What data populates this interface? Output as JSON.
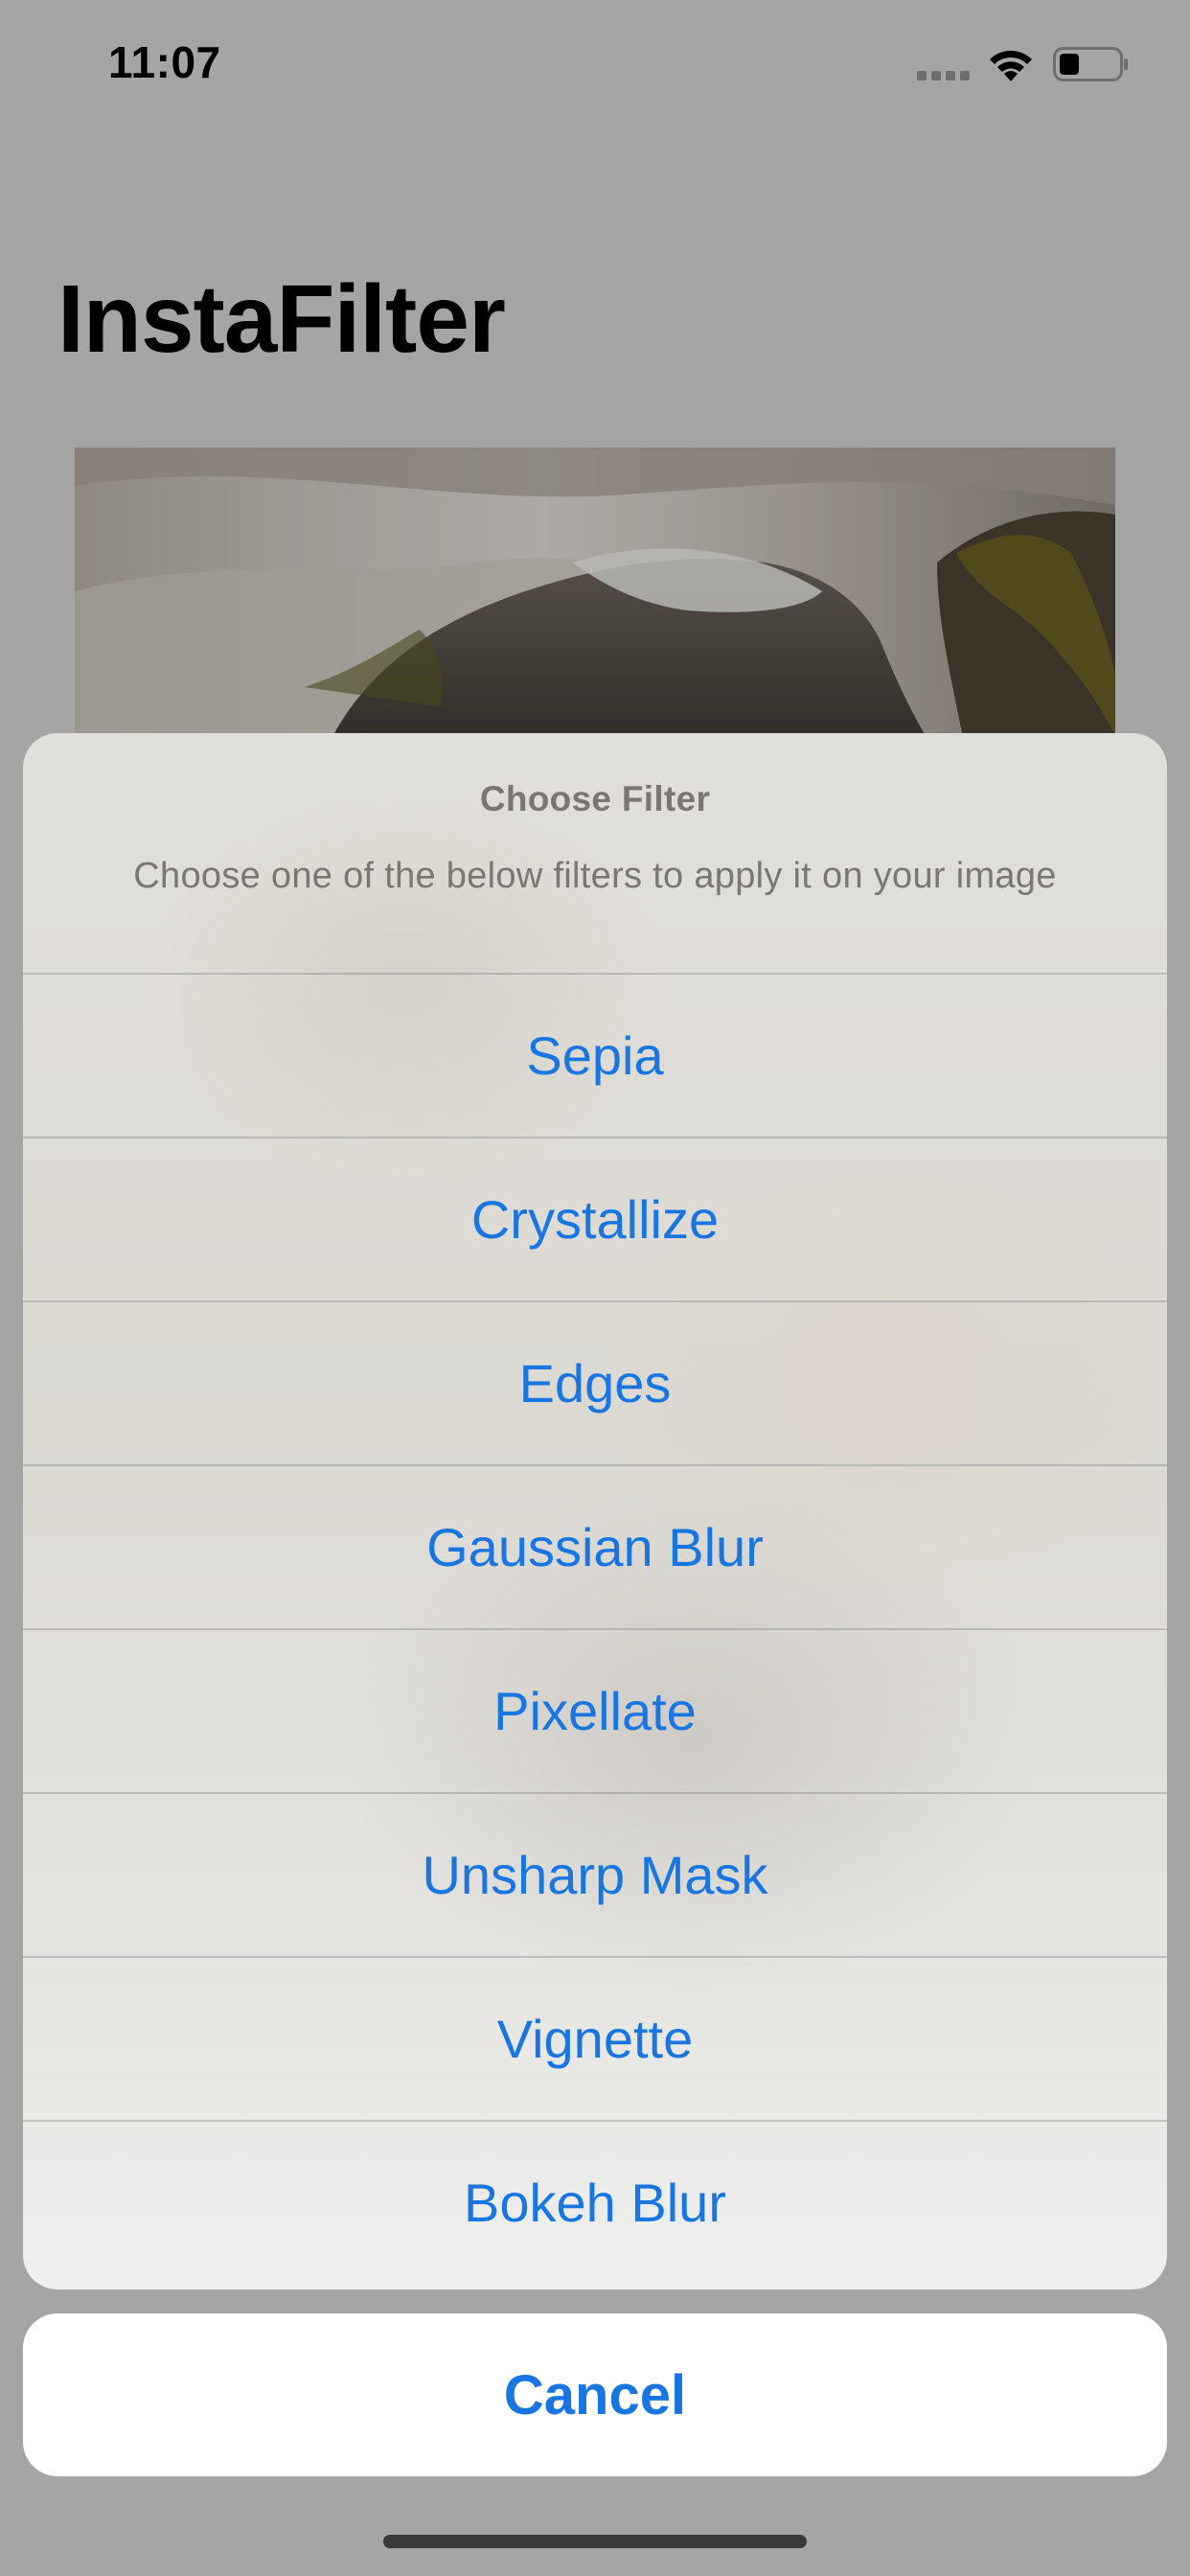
{
  "status_bar": {
    "time": "11:07"
  },
  "app": {
    "title": "InstaFilter"
  },
  "action_sheet": {
    "title": "Choose Filter",
    "message": "Choose one of the below filters to apply it on your image",
    "options": [
      "Sepia",
      "Crystallize",
      "Edges",
      "Gaussian Blur",
      "Pixellate",
      "Unsharp Mask",
      "Vignette",
      "Bokeh Blur"
    ],
    "cancel_label": "Cancel"
  },
  "colors": {
    "accent": "#1976e0",
    "title_text": "#000000",
    "sheet_secondary_text": "#7a7672"
  },
  "icons": {
    "signal": "cellular-signal-icon",
    "wifi": "wifi-icon",
    "battery": "battery-icon"
  }
}
